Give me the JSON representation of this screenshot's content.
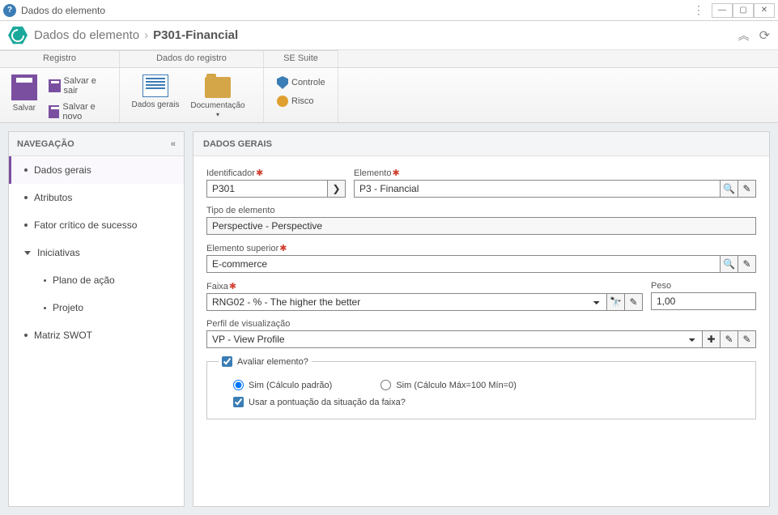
{
  "titlebar": {
    "title": "Dados do elemento"
  },
  "header": {
    "breadcrumb_label": "Dados do elemento",
    "current": "P301-Financial"
  },
  "ribbon_tabs": {
    "t1": "Registro",
    "t2": "Dados do registro",
    "t3": "SE Suite"
  },
  "ribbon": {
    "save": "Salvar",
    "save_exit": "Salvar e sair",
    "save_new": "Salvar e novo",
    "general": "Dados gerais",
    "documentation": "Documentação",
    "control": "Controle",
    "risk": "Risco"
  },
  "sidebar": {
    "title": "NAVEGAÇÃO",
    "items": {
      "general": "Dados gerais",
      "attributes": "Atributos",
      "critical": "Fator crítico de sucesso",
      "initiatives": "Iniciativas",
      "action_plan": "Plano de ação",
      "project": "Projeto",
      "swot": "Matriz SWOT"
    }
  },
  "content": {
    "title": "DADOS GERAIS",
    "labels": {
      "identifier": "Identificador",
      "element": "Elemento",
      "element_type": "Tipo de elemento",
      "parent_element": "Elemento superior",
      "range": "Faixa",
      "weight": "Peso",
      "view_profile": "Perfil de visualização"
    },
    "values": {
      "identifier": "P301",
      "element": "P3 - Financial",
      "element_type": "Perspective - Perspective",
      "parent_element": "E-commerce",
      "range": "RNG02 - % - The higher the better",
      "weight": "1,00",
      "view_profile": "VP - View Profile"
    },
    "evaluate": {
      "legend": "Avaliar elemento?",
      "opt1": "Sim (Cálculo padrão)",
      "opt2": "Sim (Cálculo Máx=100 Mín=0)",
      "use_score": "Usar a pontuação da situação da faixa?"
    }
  }
}
